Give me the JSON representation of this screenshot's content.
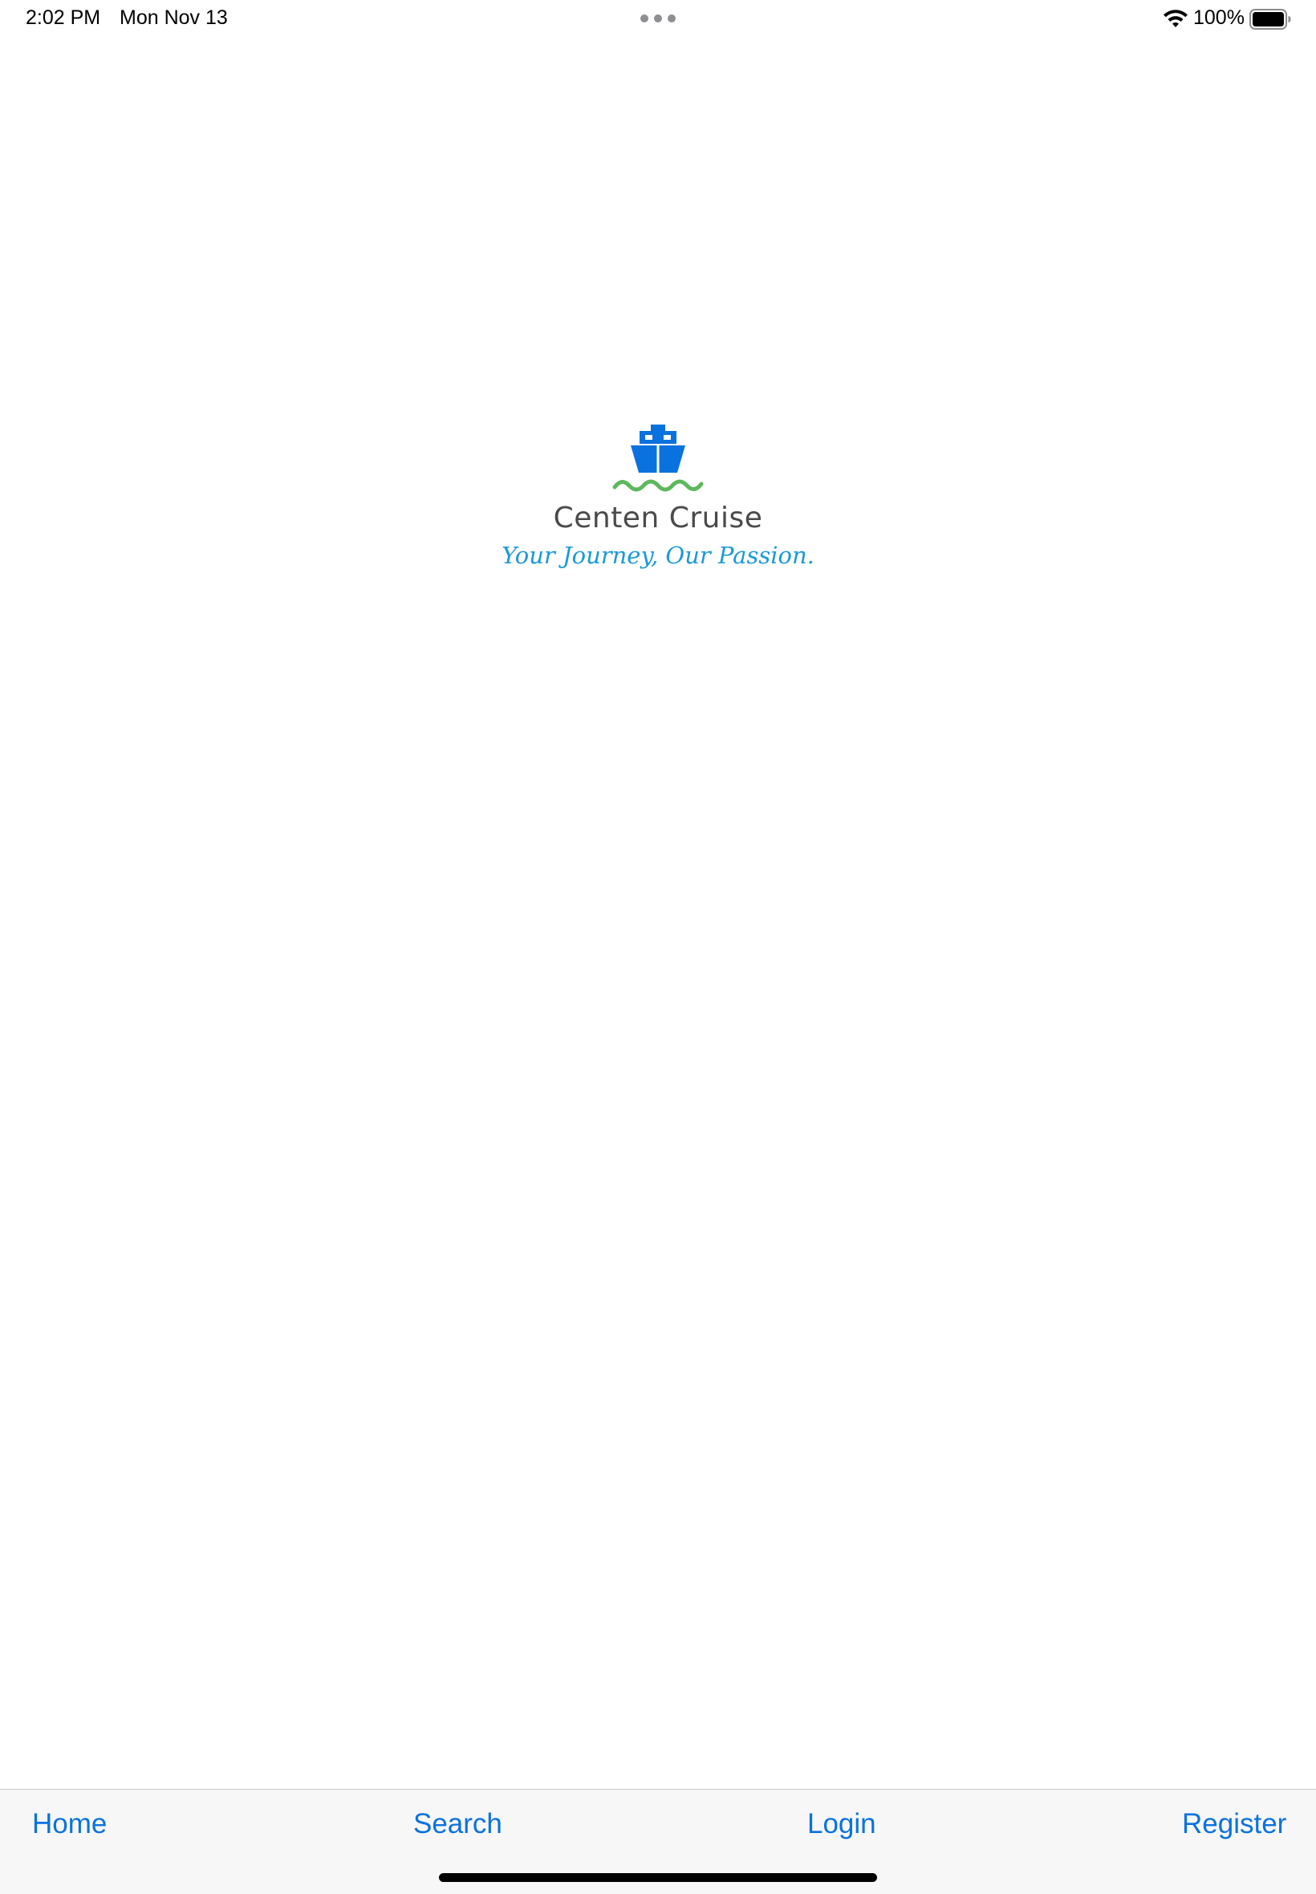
{
  "status_bar": {
    "time": "2:02 PM",
    "date": "Mon Nov 13",
    "battery_percent": "100%",
    "wifi_icon": "wifi-icon",
    "battery_icon": "battery-full-icon"
  },
  "logo": {
    "icon": "ship-icon",
    "brand_name": "Centen Cruise",
    "tagline": "Your Journey, Our Passion.",
    "colors": {
      "ship": "#0a72de",
      "waves": "#5cb85c",
      "tagline": "#1a9ad6",
      "brand_text": "#4a4a4a"
    }
  },
  "toolbar": {
    "items": [
      {
        "label": "Home"
      },
      {
        "label": "Search"
      },
      {
        "label": "Login"
      },
      {
        "label": "Register"
      }
    ],
    "accent": "#0a72de"
  }
}
